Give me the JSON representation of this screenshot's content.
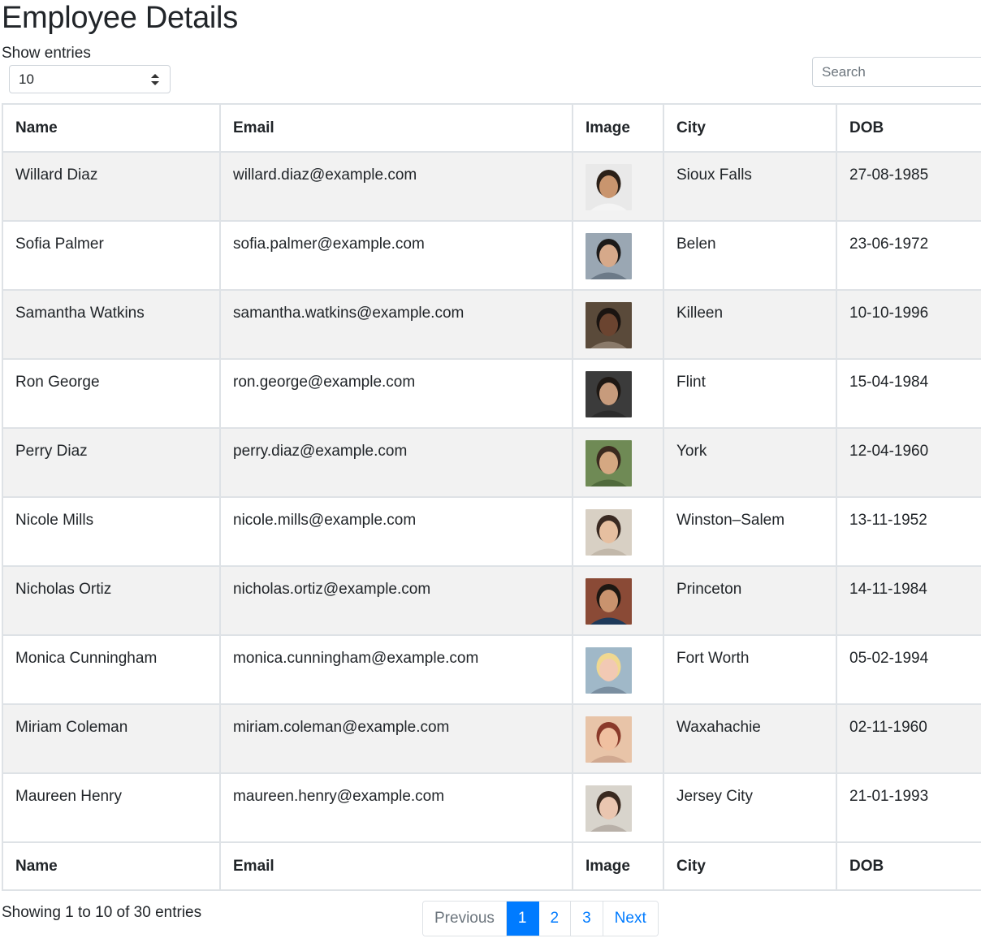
{
  "page": {
    "title": "Employee Details"
  },
  "controls": {
    "show_entries_label": "Show entries",
    "entries_value": "10",
    "search_placeholder": "Search"
  },
  "table": {
    "headers": [
      "Name",
      "Email",
      "Image",
      "City",
      "DOB"
    ],
    "rows": [
      {
        "name": "Willard Diaz",
        "email": "willard.diaz@example.com",
        "city": "Sioux Falls",
        "dob": "27-08-1985"
      },
      {
        "name": "Sofia Palmer",
        "email": "sofia.palmer@example.com",
        "city": "Belen",
        "dob": "23-06-1972"
      },
      {
        "name": "Samantha Watkins",
        "email": "samantha.watkins@example.com",
        "city": "Killeen",
        "dob": "10-10-1996"
      },
      {
        "name": "Ron George",
        "email": "ron.george@example.com",
        "city": "Flint",
        "dob": "15-04-1984"
      },
      {
        "name": "Perry Diaz",
        "email": "perry.diaz@example.com",
        "city": "York",
        "dob": "12-04-1960"
      },
      {
        "name": "Nicole Mills",
        "email": "nicole.mills@example.com",
        "city": "Winston–Salem",
        "dob": "13-11-1952"
      },
      {
        "name": "Nicholas Ortiz",
        "email": "nicholas.ortiz@example.com",
        "city": "Princeton",
        "dob": "14-11-1984"
      },
      {
        "name": "Monica Cunningham",
        "email": "monica.cunningham@example.com",
        "city": "Fort Worth",
        "dob": "05-02-1994"
      },
      {
        "name": "Miriam Coleman",
        "email": "miriam.coleman@example.com",
        "city": "Waxahachie",
        "dob": "02-11-1960"
      },
      {
        "name": "Maureen Henry",
        "email": "maureen.henry@example.com",
        "city": "Jersey City",
        "dob": "21-01-1993"
      }
    ]
  },
  "footer": {
    "info": "Showing 1 to 10 of 30 entries",
    "pagination": {
      "previous": "Previous",
      "pages": [
        "1",
        "2",
        "3"
      ],
      "next": "Next"
    }
  },
  "colors": {
    "accent": "#007bff",
    "striped_row": "#f2f2f2",
    "border": "#dee2e6"
  }
}
